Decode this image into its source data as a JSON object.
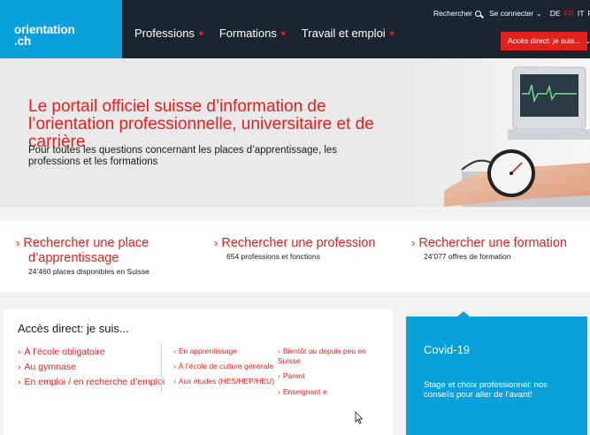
{
  "header": {
    "logo_line1": "orientation",
    "logo_line2": ".ch",
    "nav": [
      {
        "label": "Professions"
      },
      {
        "label": "Formations"
      },
      {
        "label": "Travail et emploi"
      }
    ],
    "search_label": "Rechercher",
    "login_label": "Se connecter",
    "languages": [
      "DE",
      "FR",
      "IT",
      "RM"
    ],
    "active_language": "FR",
    "access_button": "Accès direct: je suis..."
  },
  "hero": {
    "title": "Le portail officiel suisse d’information de l’orientation professionnelle, universitaire et de carrière",
    "subtitle": "Pour toutes les questions concernant les places d’apprentissage, les professions et les formations"
  },
  "quick_links": [
    {
      "line1": "Rechercher une place",
      "line2": "d’apprentissage",
      "detail": "24’460 places disponibles en Suisse"
    },
    {
      "line1": "Rechercher une profession",
      "detail": "654 professions et fonctions"
    },
    {
      "line1": "Rechercher une formation",
      "detail": "24’077 offres de formation"
    }
  ],
  "access": {
    "heading": "Accès direct: je suis...",
    "col1": [
      "À l’école obligatoire",
      "Au gymnase",
      "En emploi / en recherche d’emploi"
    ],
    "col2": [
      "En apprentissage",
      "À l’école de culture générale",
      "Aux études (HES/HEP/HEU)"
    ],
    "col3": [
      "Bientôt ou depuis peu en Suisse",
      "Parent",
      "Enseignant·e"
    ]
  },
  "covid": {
    "title": "Covid-19",
    "text": "Stage et choix professionnel: nos conseils pour aller de l’avant!"
  },
  "colors": {
    "brand_blue": "#0aa0dc",
    "header_dark": "#1c2430",
    "accent_red": "#e2211c"
  }
}
